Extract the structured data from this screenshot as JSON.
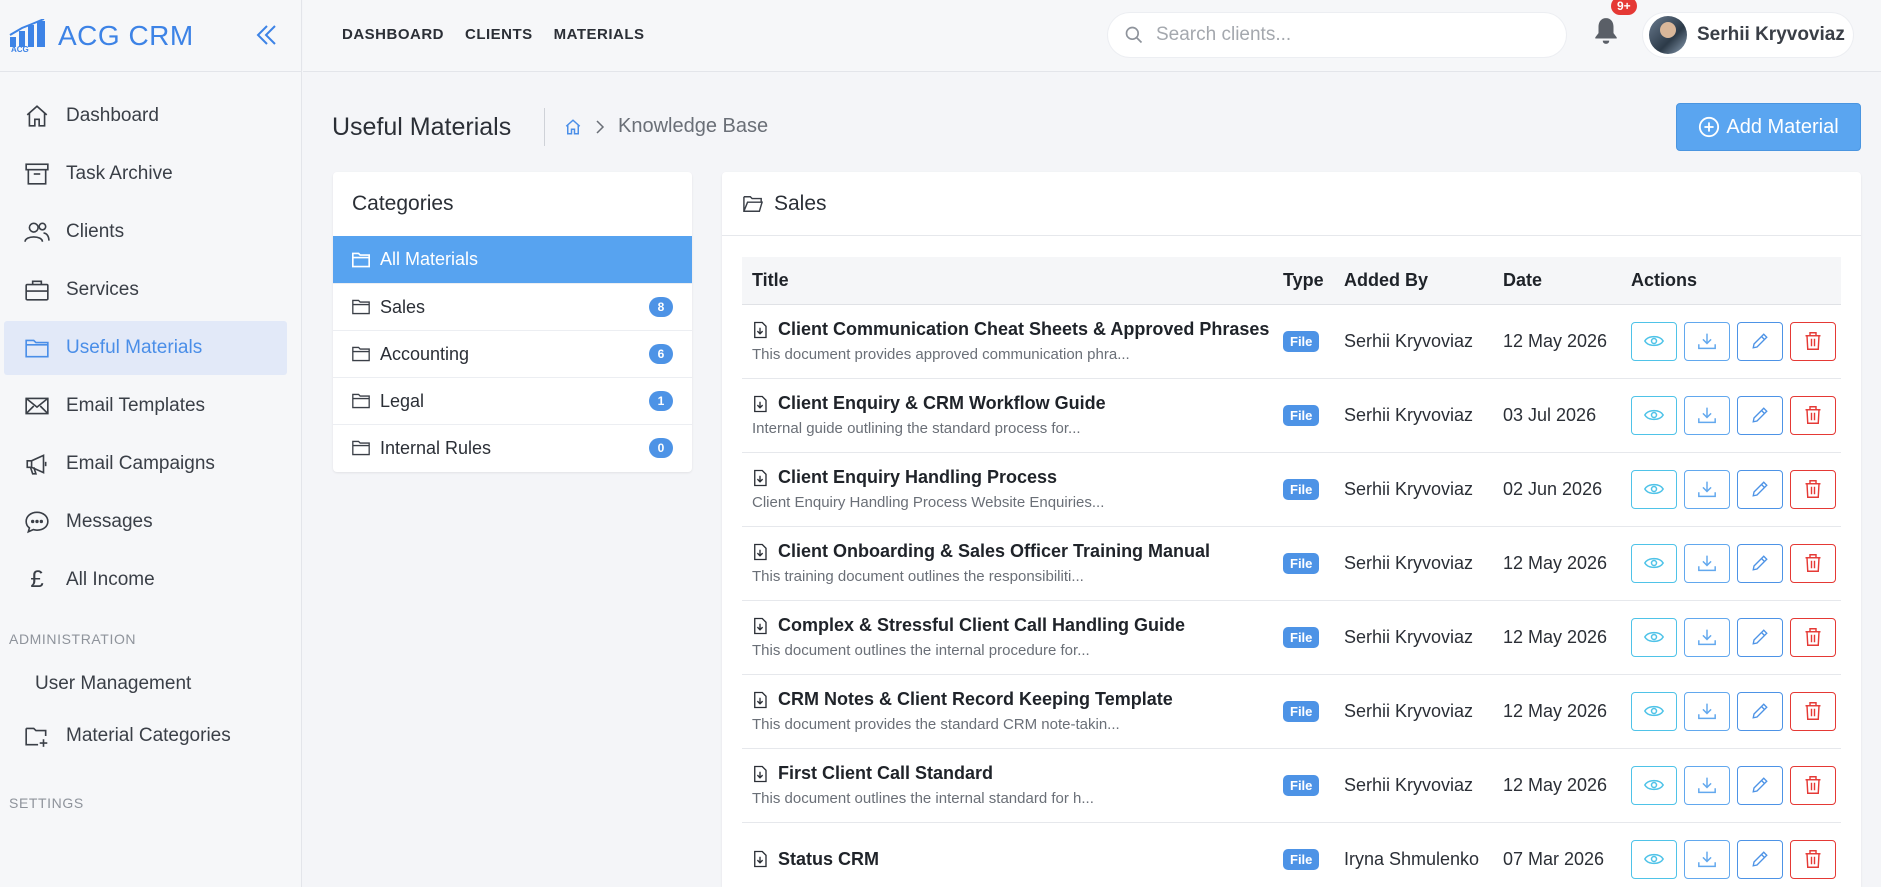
{
  "brand": {
    "name": "ACG CRM",
    "logo_text": "ACG"
  },
  "sidebar": {
    "items": [
      {
        "label": "Dashboard",
        "icon": "home-icon"
      },
      {
        "label": "Task Archive",
        "icon": "archive-icon"
      },
      {
        "label": "Clients",
        "icon": "users-icon"
      },
      {
        "label": "Services",
        "icon": "briefcase-icon"
      },
      {
        "label": "Useful Materials",
        "icon": "folder-icon",
        "active": true
      },
      {
        "label": "Email Templates",
        "icon": "envelope-icon"
      },
      {
        "label": "Email Campaigns",
        "icon": "megaphone-icon"
      },
      {
        "label": "Messages",
        "icon": "chat-icon"
      },
      {
        "label": "All Income",
        "icon": "pound-icon"
      }
    ],
    "admin_section": "ADMINISTRATION",
    "admin_items": [
      {
        "label": "User Management"
      },
      {
        "label": "Material Categories",
        "icon": "folder-plus-icon"
      }
    ],
    "settings_section": "SETTINGS"
  },
  "topnav": {
    "dashboard": "DASHBOARD",
    "clients": "CLIENTS",
    "materials": "MATERIALS"
  },
  "search": {
    "placeholder": "Search clients...",
    "value": ""
  },
  "notifications": {
    "count": "9+"
  },
  "user": {
    "name": "Serhii Kryvoviaz"
  },
  "page": {
    "title": "Useful Materials",
    "breadcrumb": "Knowledge Base",
    "add_button": "Add Material"
  },
  "categories": {
    "title": "Categories",
    "items": [
      {
        "label": "All Materials",
        "count": ""
      },
      {
        "label": "Sales",
        "count": "8"
      },
      {
        "label": "Accounting",
        "count": "6"
      },
      {
        "label": "Legal",
        "count": "1"
      },
      {
        "label": "Internal Rules",
        "count": "0"
      }
    ]
  },
  "materials": {
    "title": "Sales",
    "columns": {
      "title": "Title",
      "type": "Type",
      "added_by": "Added By",
      "date": "Date",
      "actions": "Actions"
    },
    "rows": [
      {
        "title": "Client Communication Cheat Sheets & Approved Phrases",
        "desc": "This document provides approved communication phra...",
        "type": "File",
        "added_by": "Serhii Kryvoviaz",
        "date": "12 May 2026"
      },
      {
        "title": "Client Enquiry & CRM Workflow Guide",
        "desc": "Internal guide outlining the standard process for...",
        "type": "File",
        "added_by": "Serhii Kryvoviaz",
        "date": "03 Jul 2026"
      },
      {
        "title": "Client Enquiry Handling Process",
        "desc": "Client Enquiry Handling Process Website Enquiries...",
        "type": "File",
        "added_by": "Serhii Kryvoviaz",
        "date": "02 Jun 2026"
      },
      {
        "title": "Client Onboarding & Sales Officer Training Manual",
        "desc": "This training document outlines the responsibiliti...",
        "type": "File",
        "added_by": "Serhii Kryvoviaz",
        "date": "12 May 2026"
      },
      {
        "title": "Complex & Stressful Client Call Handling Guide",
        "desc": "This document outlines the internal procedure for...",
        "type": "File",
        "added_by": "Serhii Kryvoviaz",
        "date": "12 May 2026"
      },
      {
        "title": "CRM Notes & Client Record Keeping Template",
        "desc": "This document provides the standard CRM note-takin...",
        "type": "File",
        "added_by": "Serhii Kryvoviaz",
        "date": "12 May 2026"
      },
      {
        "title": "First Client Call Standard",
        "desc": "This document outlines the internal standard for h...",
        "type": "File",
        "added_by": "Serhii Kryvoviaz",
        "date": "12 May 2026"
      },
      {
        "title": "Status CRM",
        "desc": "",
        "type": "File",
        "added_by": "Iryna Shmulenko",
        "date": "07 Mar 2026"
      }
    ]
  },
  "colors": {
    "accent": "#4d93e6",
    "active_bg": "#e2e9f8",
    "danger": "#e53935",
    "info": "#4fc3e8"
  }
}
